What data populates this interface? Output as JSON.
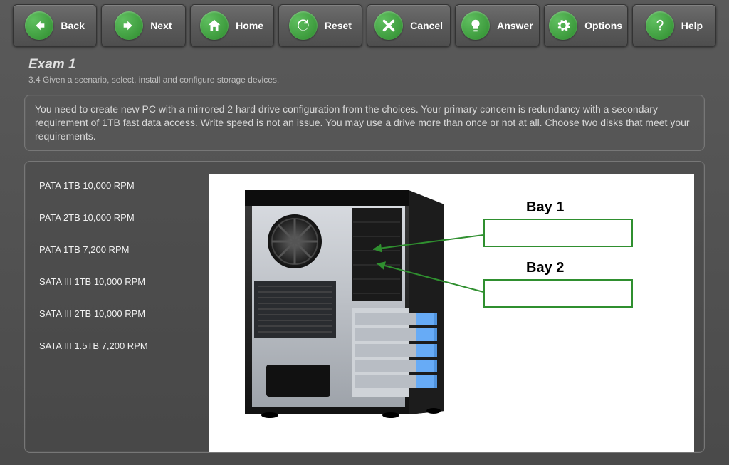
{
  "toolbar": {
    "back": {
      "label": "Back"
    },
    "next": {
      "label": "Next"
    },
    "home": {
      "label": "Home"
    },
    "reset": {
      "label": "Reset"
    },
    "cancel": {
      "label": "Cancel"
    },
    "answer": {
      "label": "Answer"
    },
    "options": {
      "label": "Options"
    },
    "help": {
      "label": "Help"
    }
  },
  "exam": {
    "title": "Exam 1",
    "objective": "3.4 Given a scenario, select, install and configure storage devices."
  },
  "question": {
    "text": "You need to create new PC with a mirrored 2 hard drive configuration from the choices. Your primary concern is redundancy with a secondary requirement of 1TB fast data access. Write speed is not an issue. You may use a drive more than once or not at all. Choose two disks that meet your requirements."
  },
  "drives": [
    "PATA 1TB 10,000 RPM",
    "PATA 2TB 10,000 RPM",
    "PATA 1TB 7,200 RPM",
    "SATA III 1TB 10,000 RPM",
    "SATA III 2TB 10,000 RPM",
    "SATA III 1.5TB 7,200 RPM"
  ],
  "bays": {
    "bay1": {
      "label": "Bay 1"
    },
    "bay2": {
      "label": "Bay 2"
    }
  },
  "colors": {
    "accent_green": "#2e8b2e",
    "border_green": "#2f8f2f"
  }
}
